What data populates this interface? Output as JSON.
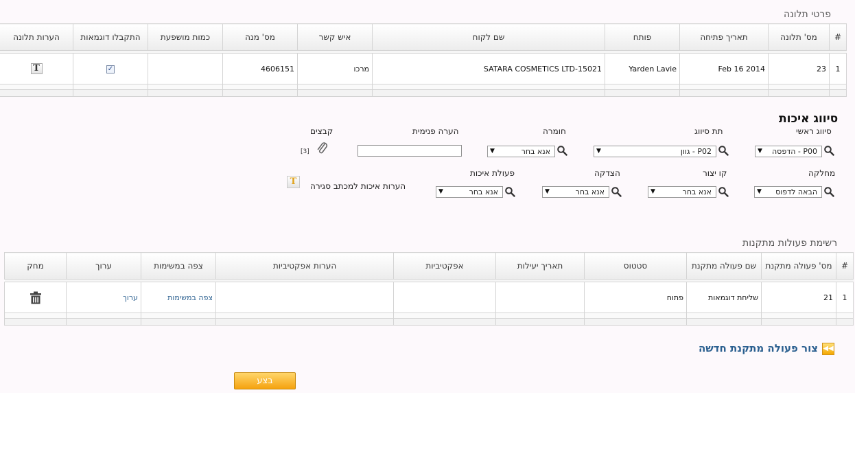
{
  "complaint_section": {
    "title": "פרטי תלונה",
    "columns": [
      "#",
      "מס' תלונה",
      "תאריך פתיחה",
      "פותח",
      "שם לקוח",
      "איש קשר",
      "מס' מנה",
      "כמות מושפעת",
      "התקבלו דוגמאות",
      "הערות תלונה"
    ],
    "row": {
      "index": "1",
      "complaint_no": "23",
      "open_date": "Feb 16 2014",
      "opener": "Yarden Lavie",
      "customer": "SATARA COSMETICS LTD-15021",
      "contact": "מרכו",
      "batch_no": "4606151",
      "affected_qty": "",
      "samples_received": true
    }
  },
  "quality": {
    "title": "סיווג איכות",
    "main_class": {
      "label": "סיווג ראשי",
      "value": "P00 - הדפסה"
    },
    "sub_class": {
      "label": "תת סיווג",
      "value": "P02 - גוון"
    },
    "severity": {
      "label": "חומרה",
      "value": "אנא בחר"
    },
    "internal_note": {
      "label": "הערה פנימית",
      "value": ""
    },
    "files": {
      "label": "קבצים",
      "count": "[3]"
    },
    "department": {
      "label": "מחלקה",
      "value": "הבאה לדפוס"
    },
    "production_line": {
      "label": "קו יצור",
      "value": "אנא בחר"
    },
    "justification": {
      "label": "הצדקה",
      "value": "אנא בחר"
    },
    "quality_action": {
      "label": "פעולת איכות",
      "value": "אנא בחר"
    },
    "closing_notes": {
      "label": "הערות איכות למכתב סגירה"
    }
  },
  "corrective": {
    "title": "רשימת פעולות מתקנות",
    "columns": [
      "#",
      "מס' פעולה מתקנת",
      "שם פעולה מתקנת",
      "סטטוס",
      "תאריך יעילות",
      "אפקטיביות",
      "הערות אפקטיביות",
      "צפה במשימות",
      "ערוך",
      "מחק"
    ],
    "row": {
      "index": "1",
      "action_no": "21",
      "action_name": "שליחת דוגמאות",
      "status": "פתוח",
      "efficiency_date": "",
      "effectiveness": "",
      "effectiveness_notes": "",
      "view_tasks": "צפה במשימות",
      "edit": "ערוך"
    }
  },
  "new_action_link": "צור פעולה מתקנת חדשה",
  "back_button": "בצע",
  "icons": {
    "search": "magnifier-icon",
    "attach": "paperclip-icon",
    "text": "text-box-icon",
    "delete": "trash-icon",
    "forward": "fast-forward-icon"
  },
  "colors": {
    "accent": "#f5a20f",
    "link": "#2a5f8f"
  }
}
